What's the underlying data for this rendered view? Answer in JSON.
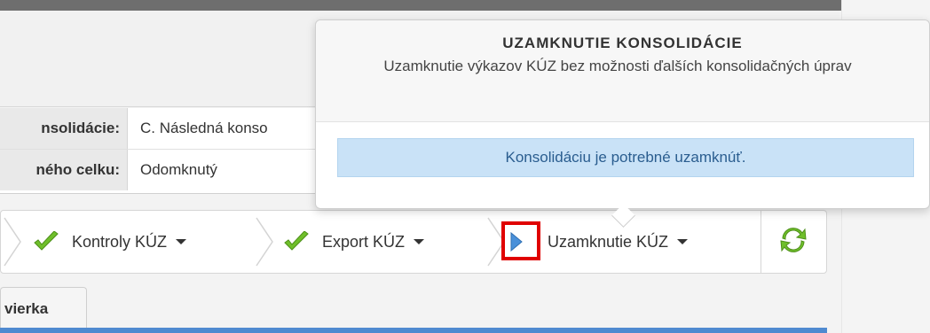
{
  "header": {},
  "info": {
    "consolidation_label": "nsolidácie:",
    "consolidation_value": "C. Následná konso",
    "status_label": "ného celku:",
    "status_value": "Odomknutý"
  },
  "toolbar": {
    "kontroly_label": "Kontroly KÚZ",
    "export_label": "Export KÚZ",
    "uzamknutie_label": "Uzamknutie KÚZ"
  },
  "tabs": {
    "active_label": "vierka"
  },
  "popover": {
    "title": "UZAMKNUTIE KONSOLIDÁCIE",
    "subtitle": "Uzamknutie výkazov KÚZ bez možnosti ďalších konsolidačných úprav",
    "message": "Konsolidáciu je potrebné uzamknúť."
  },
  "colors": {
    "highlight_border": "#e00000",
    "check_green": "#6fbf2a",
    "play_blue": "#4a90d9",
    "info_blue": "#c9e2f7"
  },
  "icons": [
    "check-icon",
    "play-icon",
    "refresh-icon",
    "caret-down-icon"
  ]
}
